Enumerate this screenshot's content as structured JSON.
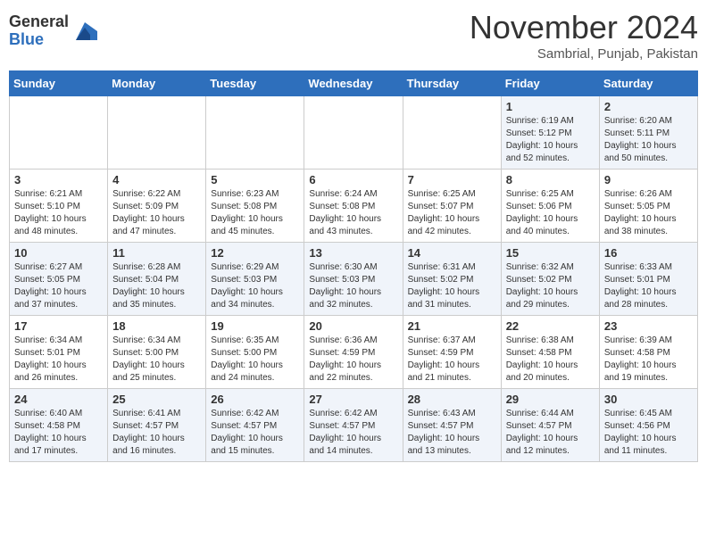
{
  "logo": {
    "general": "General",
    "blue": "Blue"
  },
  "title": "November 2024",
  "location": "Sambrial, Punjab, Pakistan",
  "days_of_week": [
    "Sunday",
    "Monday",
    "Tuesday",
    "Wednesday",
    "Thursday",
    "Friday",
    "Saturday"
  ],
  "rows": [
    [
      {
        "day": "",
        "info": ""
      },
      {
        "day": "",
        "info": ""
      },
      {
        "day": "",
        "info": ""
      },
      {
        "day": "",
        "info": ""
      },
      {
        "day": "",
        "info": ""
      },
      {
        "day": "1",
        "info": "Sunrise: 6:19 AM\nSunset: 5:12 PM\nDaylight: 10 hours\nand 52 minutes."
      },
      {
        "day": "2",
        "info": "Sunrise: 6:20 AM\nSunset: 5:11 PM\nDaylight: 10 hours\nand 50 minutes."
      }
    ],
    [
      {
        "day": "3",
        "info": "Sunrise: 6:21 AM\nSunset: 5:10 PM\nDaylight: 10 hours\nand 48 minutes."
      },
      {
        "day": "4",
        "info": "Sunrise: 6:22 AM\nSunset: 5:09 PM\nDaylight: 10 hours\nand 47 minutes."
      },
      {
        "day": "5",
        "info": "Sunrise: 6:23 AM\nSunset: 5:08 PM\nDaylight: 10 hours\nand 45 minutes."
      },
      {
        "day": "6",
        "info": "Sunrise: 6:24 AM\nSunset: 5:08 PM\nDaylight: 10 hours\nand 43 minutes."
      },
      {
        "day": "7",
        "info": "Sunrise: 6:25 AM\nSunset: 5:07 PM\nDaylight: 10 hours\nand 42 minutes."
      },
      {
        "day": "8",
        "info": "Sunrise: 6:25 AM\nSunset: 5:06 PM\nDaylight: 10 hours\nand 40 minutes."
      },
      {
        "day": "9",
        "info": "Sunrise: 6:26 AM\nSunset: 5:05 PM\nDaylight: 10 hours\nand 38 minutes."
      }
    ],
    [
      {
        "day": "10",
        "info": "Sunrise: 6:27 AM\nSunset: 5:05 PM\nDaylight: 10 hours\nand 37 minutes."
      },
      {
        "day": "11",
        "info": "Sunrise: 6:28 AM\nSunset: 5:04 PM\nDaylight: 10 hours\nand 35 minutes."
      },
      {
        "day": "12",
        "info": "Sunrise: 6:29 AM\nSunset: 5:03 PM\nDaylight: 10 hours\nand 34 minutes."
      },
      {
        "day": "13",
        "info": "Sunrise: 6:30 AM\nSunset: 5:03 PM\nDaylight: 10 hours\nand 32 minutes."
      },
      {
        "day": "14",
        "info": "Sunrise: 6:31 AM\nSunset: 5:02 PM\nDaylight: 10 hours\nand 31 minutes."
      },
      {
        "day": "15",
        "info": "Sunrise: 6:32 AM\nSunset: 5:02 PM\nDaylight: 10 hours\nand 29 minutes."
      },
      {
        "day": "16",
        "info": "Sunrise: 6:33 AM\nSunset: 5:01 PM\nDaylight: 10 hours\nand 28 minutes."
      }
    ],
    [
      {
        "day": "17",
        "info": "Sunrise: 6:34 AM\nSunset: 5:01 PM\nDaylight: 10 hours\nand 26 minutes."
      },
      {
        "day": "18",
        "info": "Sunrise: 6:34 AM\nSunset: 5:00 PM\nDaylight: 10 hours\nand 25 minutes."
      },
      {
        "day": "19",
        "info": "Sunrise: 6:35 AM\nSunset: 5:00 PM\nDaylight: 10 hours\nand 24 minutes."
      },
      {
        "day": "20",
        "info": "Sunrise: 6:36 AM\nSunset: 4:59 PM\nDaylight: 10 hours\nand 22 minutes."
      },
      {
        "day": "21",
        "info": "Sunrise: 6:37 AM\nSunset: 4:59 PM\nDaylight: 10 hours\nand 21 minutes."
      },
      {
        "day": "22",
        "info": "Sunrise: 6:38 AM\nSunset: 4:58 PM\nDaylight: 10 hours\nand 20 minutes."
      },
      {
        "day": "23",
        "info": "Sunrise: 6:39 AM\nSunset: 4:58 PM\nDaylight: 10 hours\nand 19 minutes."
      }
    ],
    [
      {
        "day": "24",
        "info": "Sunrise: 6:40 AM\nSunset: 4:58 PM\nDaylight: 10 hours\nand 17 minutes."
      },
      {
        "day": "25",
        "info": "Sunrise: 6:41 AM\nSunset: 4:57 PM\nDaylight: 10 hours\nand 16 minutes."
      },
      {
        "day": "26",
        "info": "Sunrise: 6:42 AM\nSunset: 4:57 PM\nDaylight: 10 hours\nand 15 minutes."
      },
      {
        "day": "27",
        "info": "Sunrise: 6:42 AM\nSunset: 4:57 PM\nDaylight: 10 hours\nand 14 minutes."
      },
      {
        "day": "28",
        "info": "Sunrise: 6:43 AM\nSunset: 4:57 PM\nDaylight: 10 hours\nand 13 minutes."
      },
      {
        "day": "29",
        "info": "Sunrise: 6:44 AM\nSunset: 4:57 PM\nDaylight: 10 hours\nand 12 minutes."
      },
      {
        "day": "30",
        "info": "Sunrise: 6:45 AM\nSunset: 4:56 PM\nDaylight: 10 hours\nand 11 minutes."
      }
    ]
  ]
}
